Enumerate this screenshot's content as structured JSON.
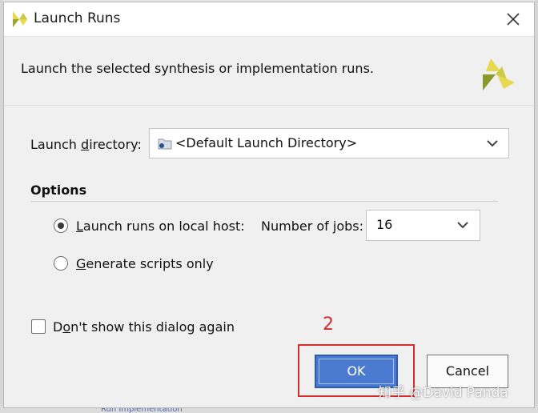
{
  "window": {
    "title": "Launch Runs",
    "logo_icon": "xilinx-logo-icon",
    "close_icon": "close-icon"
  },
  "header": {
    "description": "Launch the selected synthesis or implementation runs."
  },
  "launch_directory": {
    "label_pre": "Launch ",
    "label_u": "d",
    "label_post": "irectory:",
    "value": "<Default Launch Directory>",
    "icon": "folder-icon"
  },
  "options": {
    "title": "Options",
    "local_host": {
      "label_u": "L",
      "label_rest": "aunch runs on local host:",
      "selected": true
    },
    "jobs": {
      "label_pre": "Number of ",
      "label_u": "j",
      "label_post": "obs:",
      "value": "16"
    },
    "scripts": {
      "label_u": "G",
      "label_rest": "enerate scripts only",
      "selected": false
    }
  },
  "dont_show": {
    "label_pre": "D",
    "label_u": "o",
    "label_post": "n't show this dialog again",
    "checked": false
  },
  "annotation": {
    "number": "2",
    "color": "#d42b2b"
  },
  "buttons": {
    "ok": "OK",
    "cancel": "Cancel"
  },
  "watermark": "知乎 @David Panda",
  "background": {
    "link_fragment": "Run Implementation"
  },
  "colors": {
    "ok_button": "#4a7bd0",
    "logo_yellow": "#e2d54a",
    "logo_green": "#8a9a2a"
  }
}
